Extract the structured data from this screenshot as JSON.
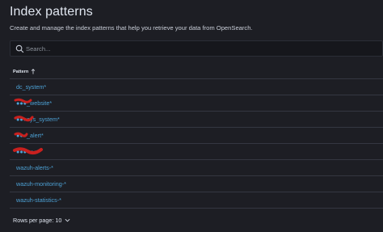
{
  "page": {
    "title": "Index patterns",
    "subtitle": "Create and manage the index patterns that help you retrieve your data from OpenSearch."
  },
  "search": {
    "placeholder": "Search..."
  },
  "table": {
    "column_header": "Pattern",
    "rows": [
      "dc_system*",
      "●●●_website*",
      "●●●ays_system*",
      "●●●_alert*",
      "●●●●●●*",
      "wazuh-alerts-*",
      "wazuh-monitoring-*",
      "wazuh-statistics-*"
    ]
  },
  "footer": {
    "rows_per_page": "Rows per page: 10"
  },
  "colors": {
    "background": "#1d1e24",
    "link": "#4da2d6",
    "border": "#343741",
    "redaction": "#c8201e"
  }
}
